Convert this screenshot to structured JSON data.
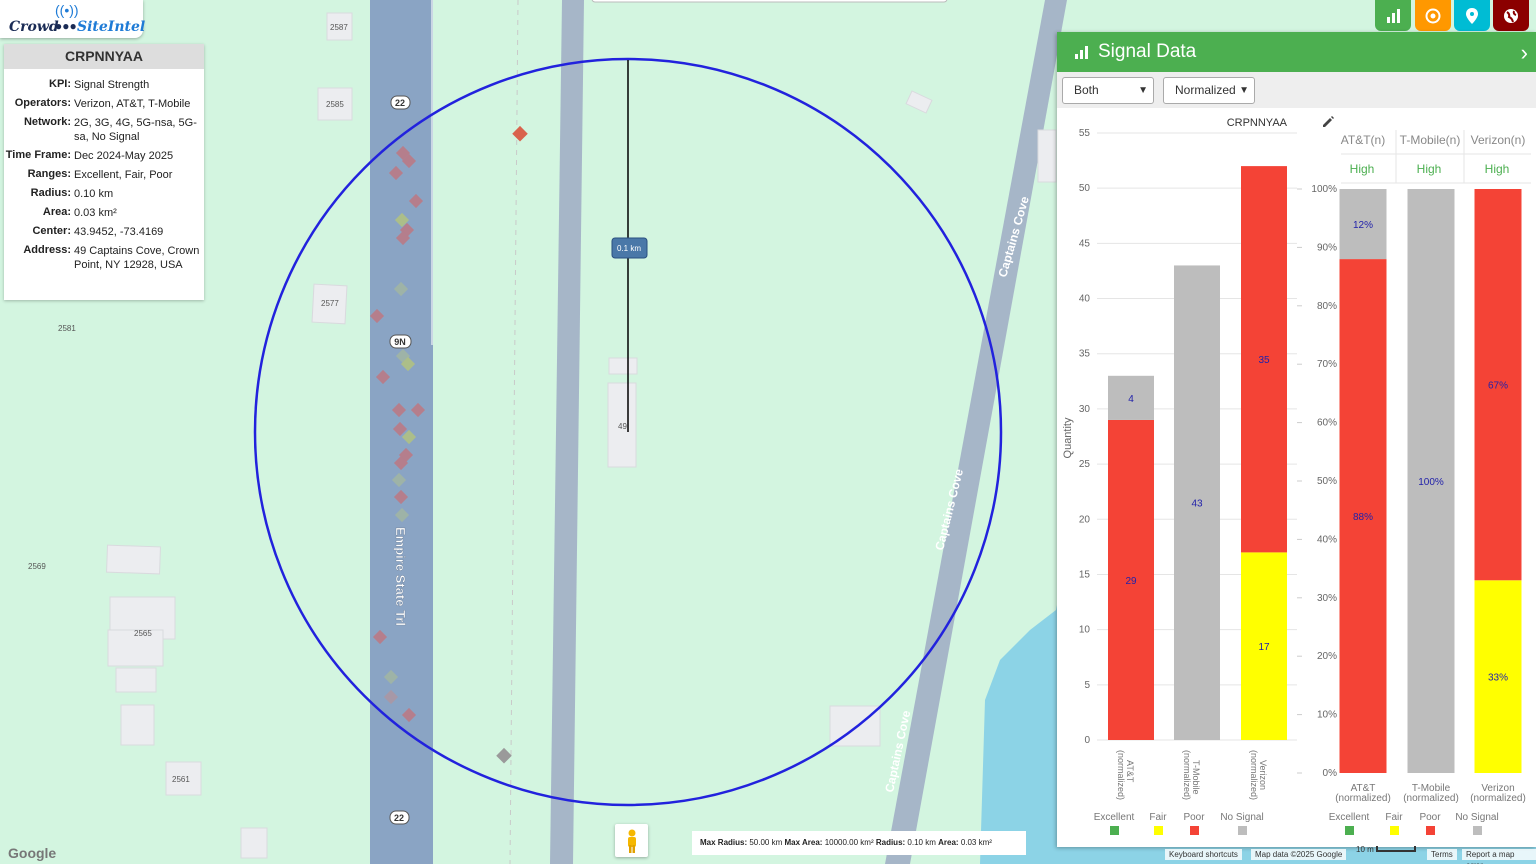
{
  "logo": {
    "crowd": "Crowd",
    "site": "SiteIntel"
  },
  "info": {
    "site_id": "CRPNNYAA",
    "rows": [
      {
        "key": "KPI:",
        "value": "Signal Strength"
      },
      {
        "key": "Operators:",
        "value": "Verizon, AT&T, T-Mobile"
      },
      {
        "key": "Network:",
        "value": "2G, 3G, 4G, 5G-nsa, 5G-sa, No Signal"
      },
      {
        "key": "Time Frame:",
        "value": "Dec 2024-May 2025"
      },
      {
        "key": "Ranges:",
        "value": "Excellent, Fair, Poor"
      },
      {
        "key": "Radius:",
        "value": "0.10 km"
      },
      {
        "key": "Area:",
        "value": "0.03 km²"
      },
      {
        "key": "Center:",
        "value": "43.9452, -73.4169"
      },
      {
        "key": "Address:",
        "value": "49 Captains Cove, Crown Point, NY 12928, USA"
      }
    ]
  },
  "map": {
    "road_main": "Empire State Trl",
    "road_cove": "Captains Cove",
    "shields": [
      "22",
      "9N",
      "22"
    ],
    "parcels": [
      "2587",
      "2585",
      "2577",
      "2581",
      "2569",
      "2565",
      "2561",
      "49"
    ],
    "measure_label": "0.1 km"
  },
  "toolbar": {
    "buttons": [
      {
        "name": "chart-icon",
        "color": "#4caf50"
      },
      {
        "name": "target-icon",
        "color": "#ff9800"
      },
      {
        "name": "map-pin-icon",
        "color": "#00bcd4"
      },
      {
        "name": "globe-icon",
        "color": "#8b0000"
      }
    ]
  },
  "panel": {
    "title": "Signal Data",
    "select_operator": "Both",
    "select_mode": "Normalized",
    "chart_title": "CRPNNYAA"
  },
  "legend": {
    "items": [
      {
        "label": "Excellent",
        "color": "#4caf50"
      },
      {
        "label": "Fair",
        "color": "#ffff00"
      },
      {
        "label": "Poor",
        "color": "#f44336"
      },
      {
        "label": "No Signal",
        "color": "#bdbdbd"
      }
    ]
  },
  "chart_data": [
    {
      "type": "bar",
      "stacked": true,
      "title": "CRPNNYAA",
      "ylabel": "Quantity",
      "ylim": [
        0,
        55
      ],
      "yticks": [
        0,
        5,
        10,
        15,
        20,
        25,
        30,
        35,
        40,
        45,
        50,
        55
      ],
      "categories": [
        "AT&T (normalized)",
        "T-Mobile (normalized)",
        "Verizon (normalized)"
      ],
      "series": [
        {
          "name": "Excellent",
          "color": "#4caf50",
          "values": [
            0,
            0,
            0
          ]
        },
        {
          "name": "Fair",
          "color": "#ffff00",
          "values": [
            0,
            0,
            17
          ]
        },
        {
          "name": "Poor",
          "color": "#f44336",
          "values": [
            29,
            0,
            35
          ]
        },
        {
          "name": "No Signal",
          "color": "#bdbdbd",
          "values": [
            4,
            43,
            0
          ]
        }
      ]
    },
    {
      "type": "bar",
      "stacked": true,
      "ylim": [
        0,
        100
      ],
      "yticks": [
        "0%",
        "10%",
        "20%",
        "30%",
        "40%",
        "50%",
        "60%",
        "70%",
        "80%",
        "90%",
        "100%"
      ],
      "header": [
        "AT&T(n)",
        "T-Mobile(n)",
        "Verizon(n)"
      ],
      "subheader": [
        "High",
        "High",
        "High"
      ],
      "categories": [
        "AT&T (normalized)",
        "T-Mobile (normalized)",
        "Verizon (normalized)"
      ],
      "series": [
        {
          "name": "Excellent",
          "color": "#4caf50",
          "values": [
            0,
            0,
            0
          ]
        },
        {
          "name": "Fair",
          "color": "#ffff00",
          "values": [
            0,
            0,
            33
          ]
        },
        {
          "name": "Poor",
          "color": "#f44336",
          "values": [
            88,
            0,
            67
          ]
        },
        {
          "name": "No Signal",
          "color": "#bdbdbd",
          "values": [
            12,
            100,
            0
          ]
        }
      ]
    }
  ],
  "bottom": {
    "max_radius_label": "Max Radius:",
    "max_radius": "50.00 km",
    "max_area_label": "Max Area:",
    "max_area": "10000.00 km²",
    "radius_label": "Radius:",
    "radius": "0.10 km",
    "area_label": "Area:",
    "area": "0.03 km²",
    "google": "Google",
    "keyboard": "Keyboard shortcuts",
    "mapdata": "Map data ©2025 Google",
    "scale": "10 m",
    "terms": "Terms",
    "report": "Report a map error"
  }
}
